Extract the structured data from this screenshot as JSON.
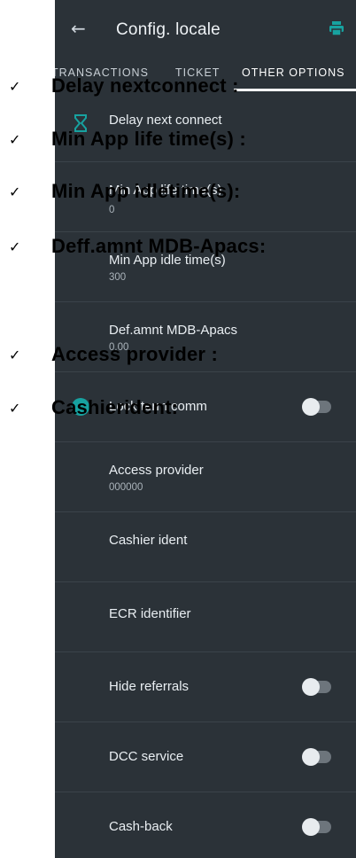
{
  "app": {
    "title": "Config. locale"
  },
  "tabs": [
    {
      "label": "TRANSACTIONS"
    },
    {
      "label": "TICKET"
    },
    {
      "label": "OTHER OPTIONS",
      "active": true
    }
  ],
  "settings": [
    {
      "title": "Delay next connect",
      "subtitle": "",
      "icon": "hourglass-icon"
    },
    {
      "title": "Min App life time(s)",
      "subtitle": "0"
    },
    {
      "title": "Min App idle time(s)",
      "subtitle": "300"
    },
    {
      "title": "Def.amnt MDB-Apacs",
      "subtitle": "0.00"
    },
    {
      "title": "Lock term comm",
      "subtitle": "",
      "toggle": "off",
      "icon": "round-teal-icon"
    },
    {
      "title": "Access provider",
      "subtitle": "000000"
    },
    {
      "title": "Cashier ident",
      "subtitle": ""
    },
    {
      "title": "ECR identifier",
      "subtitle": ""
    },
    {
      "title": "Hide referrals",
      "subtitle": "",
      "toggle": "off"
    },
    {
      "title": "DCC service",
      "subtitle": "",
      "toggle": "off"
    },
    {
      "title": "Cash-back",
      "subtitle": "",
      "toggle": "off"
    }
  ],
  "annotations": [
    {
      "check": "✓",
      "label": "Delay nextconnect :"
    },
    {
      "check": "✓",
      "label": "Min App life time(s) :"
    },
    {
      "check": "✓",
      "label": "Min App idletime(s):"
    },
    {
      "check": "✓",
      "label": "Deff.amnt  MDB-Apacs:"
    },
    {
      "check": "✓",
      "label": "Access  provider :"
    },
    {
      "check": "✓",
      "label": "Cashierident:"
    }
  ],
  "colors": {
    "background": "#2b3238",
    "accent_teal": "#17a2a0",
    "text": "#e9eef2",
    "toggle_track": "#6d757c"
  }
}
